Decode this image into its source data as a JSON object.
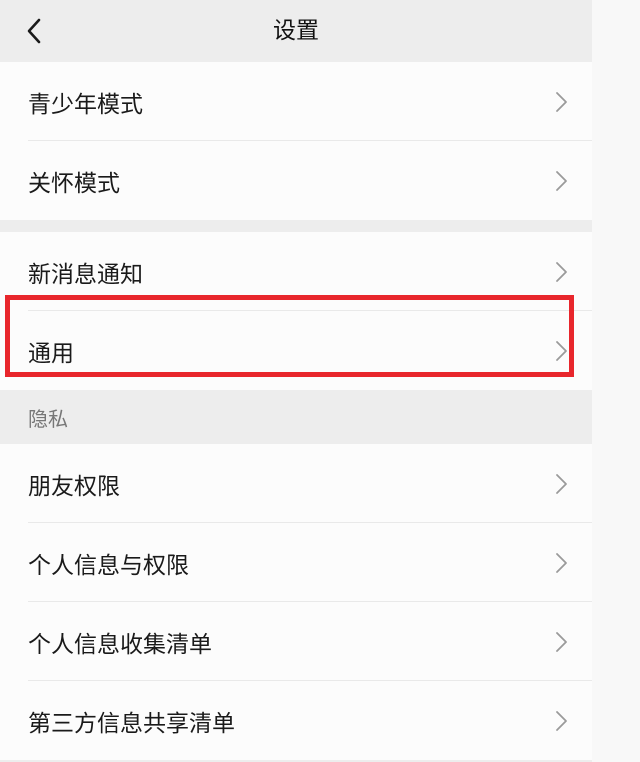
{
  "navbar": {
    "title": "设置",
    "back_icon": "chevron-left-icon"
  },
  "groups": [
    {
      "items": [
        {
          "label": "青少年模式"
        },
        {
          "label": "关怀模式"
        }
      ]
    },
    {
      "items": [
        {
          "label": "新消息通知"
        },
        {
          "label": "通用"
        }
      ]
    }
  ],
  "privacy": {
    "header": "隐私",
    "items": [
      {
        "label": "朋友权限"
      },
      {
        "label": "个人信息与权限"
      },
      {
        "label": "个人信息收集清单"
      },
      {
        "label": "第三方信息共享清单"
      }
    ]
  },
  "highlight": {
    "target": "通用",
    "color": "#e8262c"
  }
}
